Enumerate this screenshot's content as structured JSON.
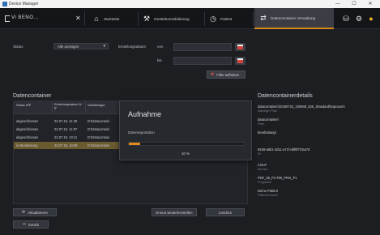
{
  "window": {
    "title": "Device Manager",
    "minimize": "—",
    "maximize": "☐",
    "close": "✕"
  },
  "app": {
    "logo": "Vi BENO...",
    "close_glyph": "✕"
  },
  "tabs": [
    {
      "label": "Startseite",
      "icon": "home-icon"
    },
    {
      "label": "Gerätekonsolidierung",
      "icon": "wrench-icon"
    },
    {
      "label": "Patient",
      "icon": "patient-icon"
    },
    {
      "label": "Datencontainer Verwaltung",
      "icon": "transfer-icon"
    }
  ],
  "filters": {
    "status_label": "Status",
    "status_value": "Alle anzeigen",
    "date_label": "Erstellungsdatum",
    "from_label": "von",
    "to_label": "bis",
    "clear_label": "Filter aufheben"
  },
  "datacontainer": {
    "title": "Datencontainer",
    "columns": [
      "Status ∆/∇",
      "Erstellungsdatum ∆/∇",
      "Vollständiger"
    ],
    "rows": [
      {
        "status": "abgeschlossen",
        "date": "23.07.19, 11:28",
        "path": "D:\\Datacontain",
        "selected": false
      },
      {
        "status": "abgeschlossen",
        "date": "23.07.19, 11:07",
        "path": "D:\\Datacontain",
        "selected": false
      },
      {
        "status": "abgeschlossen",
        "date": "23.07.19, 10:11",
        "path": "D:\\Datacontain",
        "selected": false
      },
      {
        "status": "in Bearbeitung",
        "date": "23.07.19, 10:08",
        "path": "D:\\Datacontain",
        "selected": true
      }
    ]
  },
  "buttons": {
    "refresh": "Aktualisieren",
    "reexport": "Erneut wiederherstellen",
    "delete": "Löschen",
    "back": "Zurück"
  },
  "details": {
    "title": "Datencontainerdetails",
    "items": [
      {
        "value": "datacontainer\\20190723_100948_626_Standard\\Exposure\\",
        "key": "ständiger Pfad"
      },
      {
        "value": "datacontainer\\",
        "key": "Pfad"
      },
      {
        "value": "bearbeitung\\",
        "key": ""
      },
      {
        "value": "9348-a8d1-4d11-a71f-d6f8f7f16a7d",
        "key": "ID"
      },
      {
        "value": "COLP",
        "key": "Bereich"
      },
      {
        "value": "PDF_00_PCT80_PRO_P1",
        "key": "Programm"
      },
      {
        "value": "Demo Patient",
        "key": "Patientenname"
      }
    ]
  },
  "modal": {
    "title": "Aufnahme",
    "status": "Datenexportation",
    "percent_label": "10 %",
    "progress": 0.1
  },
  "colors": {
    "accent": "#e08a1d",
    "selected_row": "#6a5a30",
    "calendar": "#d2453a"
  }
}
